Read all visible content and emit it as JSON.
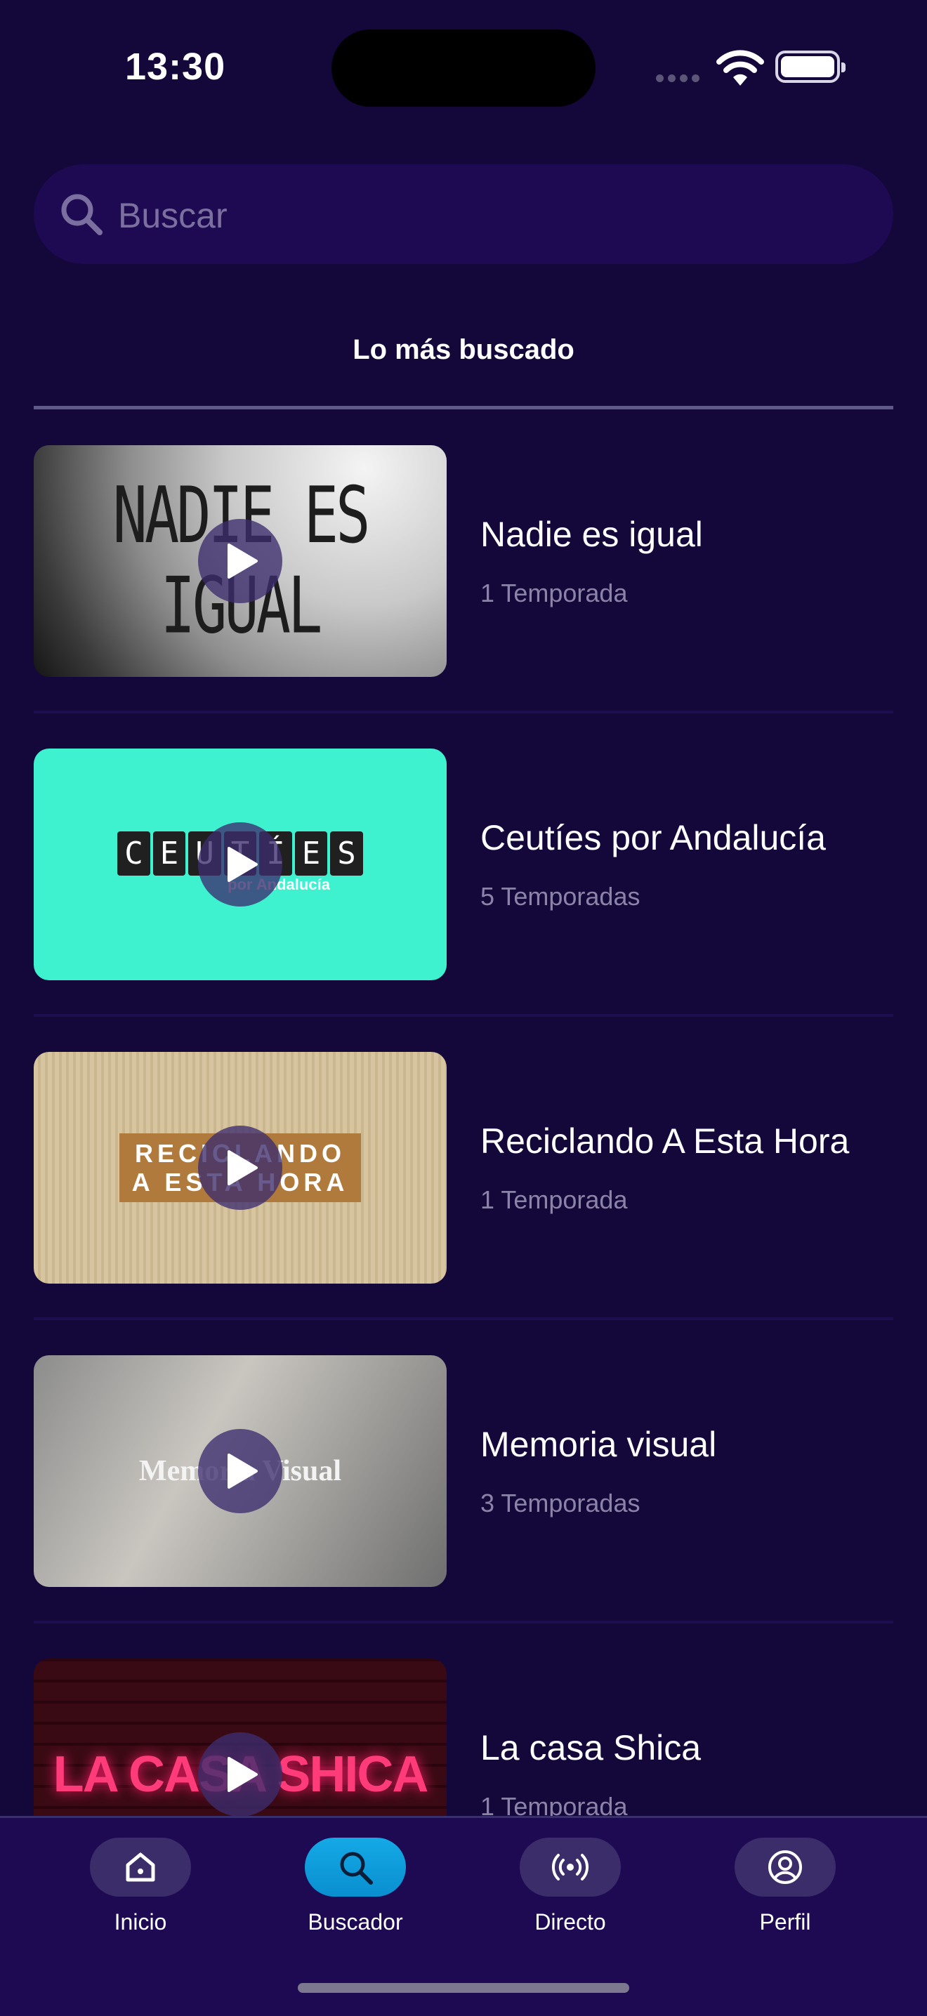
{
  "status_bar": {
    "time": "13:30"
  },
  "search": {
    "placeholder": "Buscar"
  },
  "section": {
    "title": "Lo más buscado"
  },
  "results": [
    {
      "title": "Nadie es igual",
      "subtitle": "1 Temporada",
      "thumb_text": "NADIE ES IGUAL"
    },
    {
      "title": "Ceutíes por Andalucía",
      "subtitle": "5 Temporadas",
      "thumb_letters": [
        "C",
        "E",
        "U",
        "T",
        "Í",
        "E",
        "S"
      ],
      "thumb_sub": "por Andalucía"
    },
    {
      "title": "Reciclando A Esta Hora",
      "subtitle": "1 Temporada",
      "thumb_line1": "RECICLANDO",
      "thumb_line2": "A ESTA HORA"
    },
    {
      "title": "Memoria visual",
      "subtitle": "3 Temporadas",
      "thumb_text": "Memoria Visual"
    },
    {
      "title": "La casa Shica",
      "subtitle": "1 Temporada",
      "thumb_text": "LA CASA SHICA"
    }
  ],
  "nav": {
    "items": [
      {
        "label": "Inicio",
        "icon": "home-icon",
        "active": false
      },
      {
        "label": "Buscador",
        "icon": "search-icon",
        "active": true
      },
      {
        "label": "Directo",
        "icon": "broadcast-icon",
        "active": false
      },
      {
        "label": "Perfil",
        "icon": "profile-icon",
        "active": false
      }
    ]
  },
  "colors": {
    "background": "#14073a",
    "search_bg": "#1e0a52",
    "accent": "#0ea5e9",
    "subtitle": "#8b84a8"
  }
}
